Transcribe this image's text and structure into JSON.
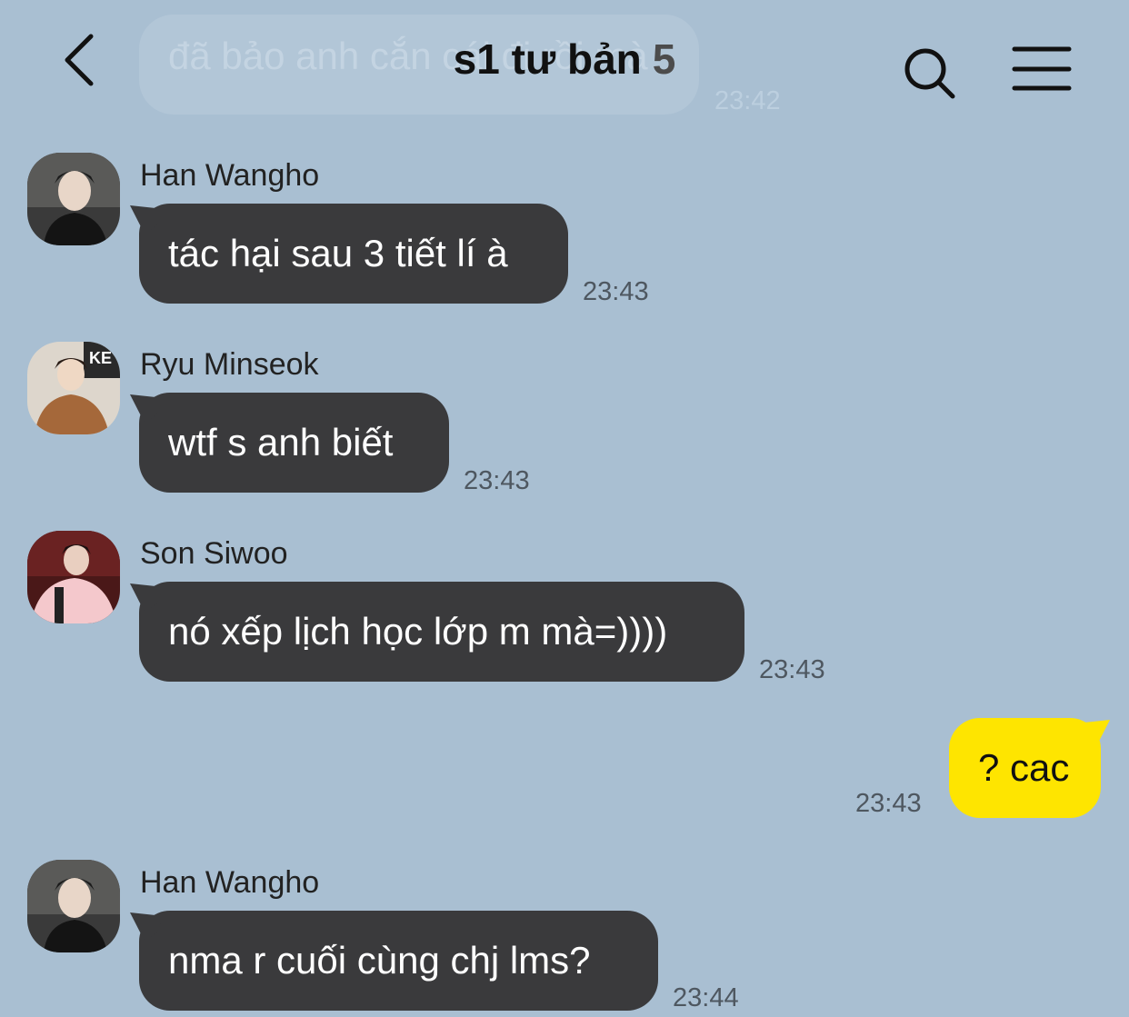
{
  "header": {
    "title": "s1 tư bản",
    "member_count": "5",
    "back_icon": "chevron-left-icon",
    "search_icon": "search-icon",
    "menu_icon": "menu-icon"
  },
  "ghost_message": {
    "text": "đã bảo anh cắn cái đi rồi mà",
    "time": "23:42"
  },
  "messages": [
    {
      "sender": "Han Wangho",
      "text": "tác hại sau 3 tiết lí à",
      "time": "23:43"
    },
    {
      "sender": "Ryu Minseok",
      "text": "wtf s anh biết",
      "time": "23:43"
    },
    {
      "sender": "Son Siwoo",
      "text": "nó xếp lịch học lớp m mà=))))",
      "time": "23:43"
    },
    {
      "sender": "me",
      "text": "? cac",
      "time": "23:43"
    },
    {
      "sender": "Han Wangho",
      "text": "nma r cuối cùng chj lms?",
      "time": "23:44"
    }
  ],
  "colors": {
    "background": "#a9bfd2",
    "incoming_bubble": "#3a3a3c",
    "outgoing_bubble": "#fee500"
  }
}
